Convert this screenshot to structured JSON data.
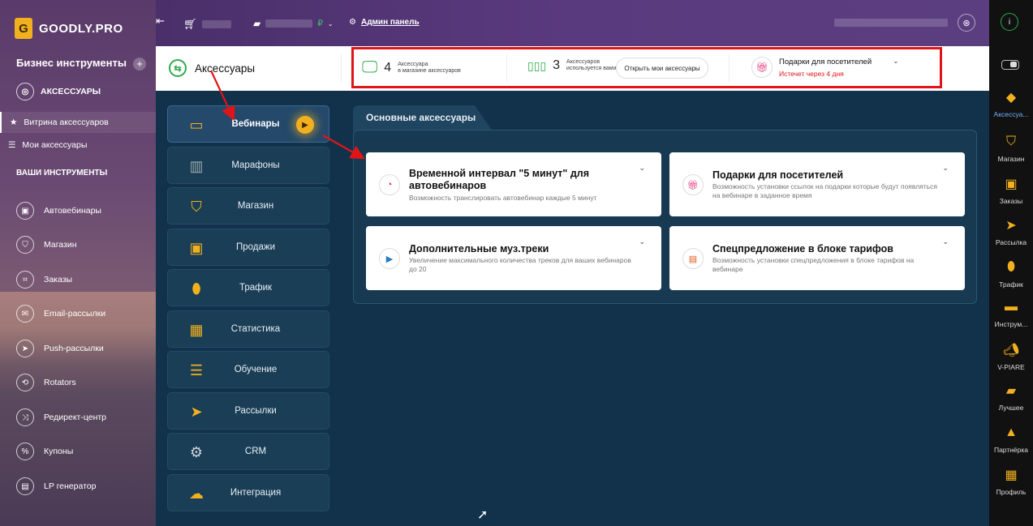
{
  "sidebar": {
    "brand": "GOODLY.PRO",
    "brand_badge": "G",
    "business_tools": "Бизнес инструменты",
    "plus": "+",
    "section": "АКСЕССУАРЫ",
    "sub_items": [
      {
        "label": "Витрина аксессуаров",
        "icon": "star-icon"
      },
      {
        "label": "Мои аксессуары",
        "icon": "list-icon"
      }
    ],
    "tools_header": "ВАШИ ИНСТРУМЕНТЫ",
    "links": [
      {
        "label": "Автовебинары",
        "icon": "webinar-icon"
      },
      {
        "label": "Магазин",
        "icon": "bag-icon"
      },
      {
        "label": "Заказы",
        "icon": "orders-icon"
      },
      {
        "label": "Email-рассылки",
        "icon": "mail-icon"
      },
      {
        "label": "Push-рассылки",
        "icon": "push-icon"
      },
      {
        "label": "Rotators",
        "icon": "rotator-icon"
      },
      {
        "label": "Редирект-центр",
        "icon": "shuffle-icon"
      },
      {
        "label": "Купоны",
        "icon": "coupon-icon"
      },
      {
        "label": "LP генератор",
        "icon": "lp-icon"
      }
    ]
  },
  "topbar": {
    "currency": "₽",
    "admin": "Админ панель"
  },
  "strip": {
    "title": "Аксессуары",
    "stat1": {
      "num": "4",
      "line1": "Аксессуара",
      "line2": "в магазине аксессуаров"
    },
    "stat2": {
      "num": "3",
      "line1": "Аксессуаров",
      "line2": "используется вами"
    },
    "open_button": "Открыть мои аксессуары",
    "gift_title": "Подарки для посетителей",
    "gift_expires": "Истечет через 4 дня"
  },
  "categories": [
    {
      "label": "Вебинары",
      "icon": "webinar-cat-icon",
      "active": true
    },
    {
      "label": "Марафоны",
      "icon": "speakers-icon"
    },
    {
      "label": "Магазин",
      "icon": "shop-bag-icon"
    },
    {
      "label": "Продажи",
      "icon": "sales-icon"
    },
    {
      "label": "Трафик",
      "icon": "mouse-icon"
    },
    {
      "label": "Статистика",
      "icon": "stats-icon"
    },
    {
      "label": "Обучение",
      "icon": "books-icon"
    },
    {
      "label": "Рассылки",
      "icon": "paper-plane-icon"
    },
    {
      "label": "CRM",
      "icon": "crm-icon"
    },
    {
      "label": "Интеграция",
      "icon": "cloud-icon"
    }
  ],
  "panel": {
    "tab": "Основные аксессуары",
    "cards": [
      {
        "title": "Временной интервал \"5 минут\" для автовебинаров",
        "desc": "Возможность транслировать автовебинар каждые 5 минут",
        "icon": "timer-icon"
      },
      {
        "title": "Подарки для посетителей",
        "desc": "Возможность установки ссылок на подарки которые будут появляться на вебинаре в заданное время",
        "icon": "gift-icon"
      },
      {
        "title": "Дополнительные муз.треки",
        "desc": "Увеличение максимального количества треков для ваших вебинаров до 20",
        "icon": "music-icon"
      },
      {
        "title": "Спецпредложение в блоке тарифов",
        "desc": "Возможность установки спецпредложения в блоке тарифов на вебинаре",
        "icon": "offer-icon"
      }
    ]
  },
  "dock": [
    {
      "label": "Аксессуа...",
      "icon": "accessories-icon",
      "active": true
    },
    {
      "label": "Магазин",
      "icon": "shop-icon"
    },
    {
      "label": "Заказы",
      "icon": "orders-box-icon"
    },
    {
      "label": "Рассылка",
      "icon": "mailing-icon"
    },
    {
      "label": "Трафик",
      "icon": "traffic-icon"
    },
    {
      "label": "Инструм...",
      "icon": "tools-icon"
    },
    {
      "label": "V-PIARE",
      "icon": "megaphone-icon"
    },
    {
      "label": "Лучшее",
      "icon": "best-icon"
    },
    {
      "label": "Партнёрка",
      "icon": "partner-icon"
    },
    {
      "label": "Профиль",
      "icon": "profile-icon"
    }
  ],
  "colors": {
    "accent": "#f2b01e",
    "highlight": "#e0151a",
    "green": "#2faa4f"
  }
}
